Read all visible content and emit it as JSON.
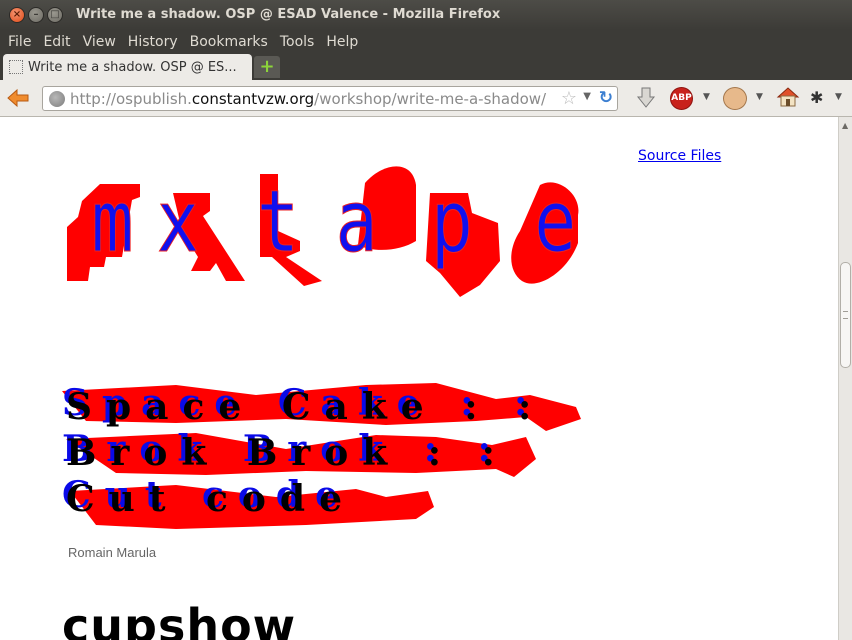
{
  "window": {
    "title": "Write me a shadow. OSP @ ESAD Valence - Mozilla Firefox"
  },
  "menu": [
    "File",
    "Edit",
    "View",
    "History",
    "Bookmarks",
    "Tools",
    "Help"
  ],
  "tabs": [
    {
      "label": "Write me a shadow. OSP @ ES..."
    }
  ],
  "url": {
    "prefix": "http://ospublish.",
    "host": "constantvzw.org",
    "path": "/workshop/write-me-a-shadow/"
  },
  "toolbar": {
    "abp_label": "ABP"
  },
  "page": {
    "source_link": "Source Files",
    "font1_letters": [
      "m",
      "x",
      "t",
      "a",
      "p",
      "e"
    ],
    "font2_lines": [
      "Space Cake : :",
      "Brok Brok : :",
      "Cut code"
    ],
    "font2_author": "Romain Marula",
    "font3_title": "cupshow"
  },
  "colors": {
    "shadow": "#ff0000",
    "letter_fill": "#1010ee",
    "link": "#0000ee"
  }
}
